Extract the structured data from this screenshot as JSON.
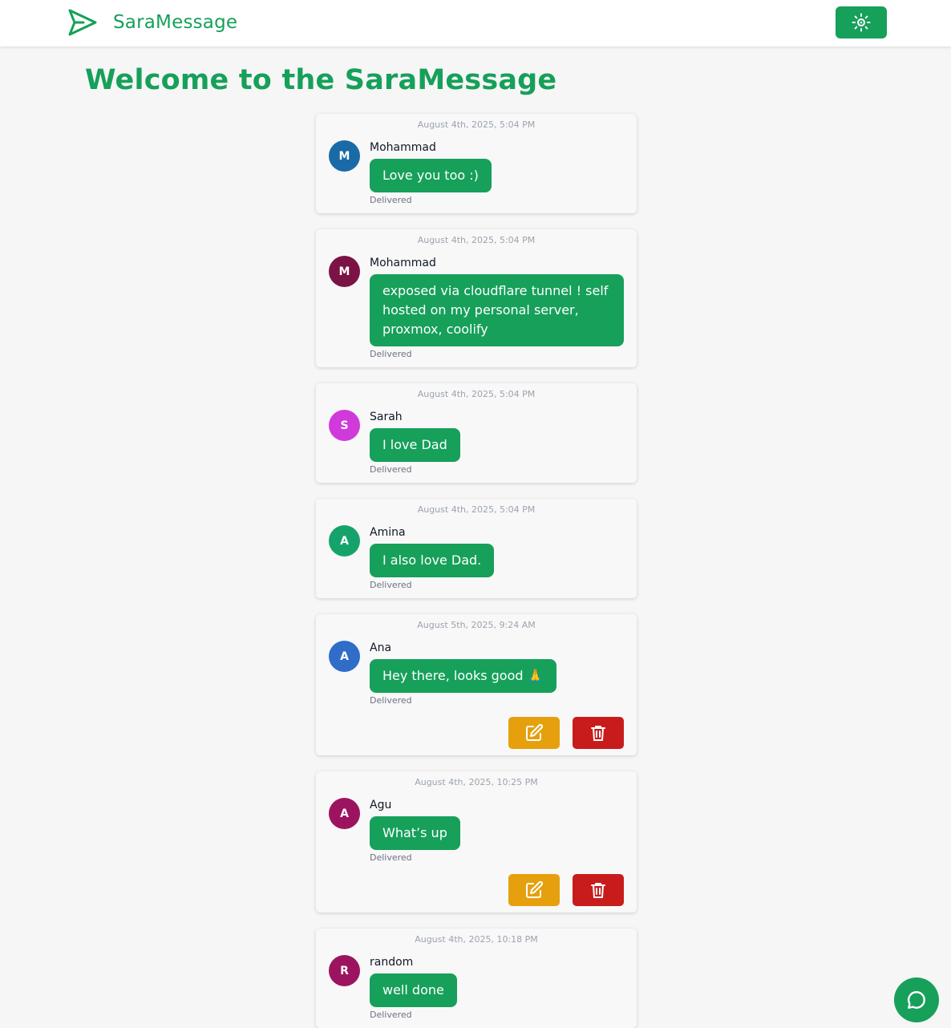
{
  "colors": {
    "primary": "#16a05a",
    "edit": "#e6a00d",
    "delete": "#c81c1c",
    "background": "#f6f6f6"
  },
  "header": {
    "brand": "SaraMessage",
    "logo_icon": "paper-plane-icon",
    "theme_toggle_icon": "sun-icon"
  },
  "page": {
    "title": "Welcome to the SaraMessage"
  },
  "messages": [
    {
      "time": "August 4th, 2025, 5:04 PM",
      "initial": "M",
      "avatar_color": "#1a6aa8",
      "name": "Mohammad",
      "text": "Love you too :)",
      "status": "Delivered",
      "actions": false
    },
    {
      "time": "August 4th, 2025, 5:04 PM",
      "initial": "M",
      "avatar_color": "#7b1445",
      "name": "Mohammad",
      "text": "exposed via cloudflare tunnel ! self hosted on my personal server, proxmox, coolify",
      "status": "Delivered",
      "actions": false
    },
    {
      "time": "August 4th, 2025, 5:04 PM",
      "initial": "S",
      "avatar_color": "#d03adb",
      "name": "Sarah",
      "text": "I love Dad",
      "status": "Delivered",
      "actions": false
    },
    {
      "time": "August 4th, 2025, 5:04 PM",
      "initial": "A",
      "avatar_color": "#16a36b",
      "name": "Amina",
      "text": "I also love Dad.",
      "status": "Delivered",
      "actions": false
    },
    {
      "time": "August 5th, 2025, 9:24 AM",
      "initial": "A",
      "avatar_color": "#2f6dc9",
      "name": "Ana",
      "text": "Hey there, looks good 🙏",
      "status": "Delivered",
      "actions": true
    },
    {
      "time": "August 4th, 2025, 10:25 PM",
      "initial": "A",
      "avatar_color": "#9c1460",
      "name": "Agu",
      "text": "What’s up",
      "status": "Delivered",
      "actions": true
    },
    {
      "time": "August 4th, 2025, 10:18 PM",
      "initial": "R",
      "avatar_color": "#9c1460",
      "name": "random",
      "text": "well done",
      "status": "Delivered",
      "actions": false
    }
  ],
  "actions": {
    "edit_icon": "edit-icon",
    "delete_icon": "trash-icon"
  },
  "fab": {
    "icon": "chat-bubble-icon"
  }
}
